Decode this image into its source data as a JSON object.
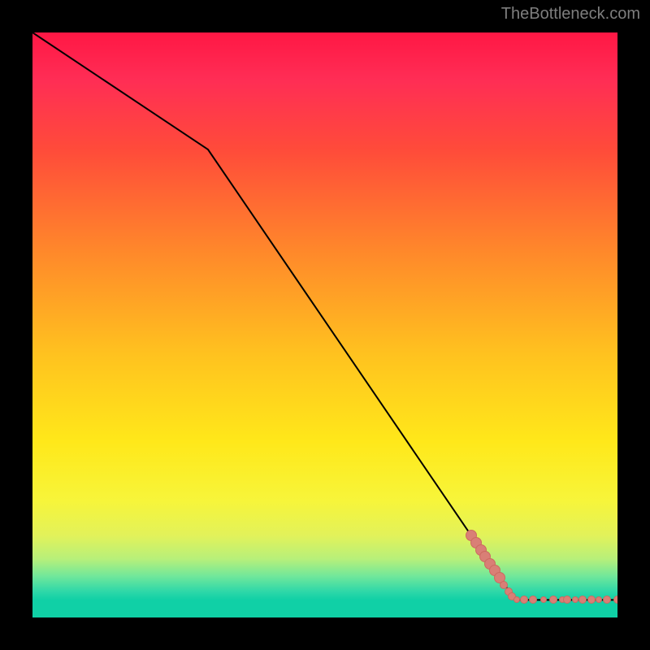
{
  "watermark": "TheBottleneck.com",
  "chart_data": {
    "type": "line",
    "title": "",
    "xlabel": "",
    "ylabel": "",
    "xlim": [
      0,
      100
    ],
    "ylim": [
      0,
      100
    ],
    "grid": false,
    "line": {
      "x": [
        0,
        30,
        82.5,
        100
      ],
      "y": [
        100,
        80,
        3,
        3
      ]
    },
    "scatter": [
      {
        "x": 75.0,
        "y": 14.0,
        "size": "big"
      },
      {
        "x": 75.8,
        "y": 12.8,
        "size": "big"
      },
      {
        "x": 76.6,
        "y": 11.6,
        "size": "big"
      },
      {
        "x": 77.4,
        "y": 10.4,
        "size": "big"
      },
      {
        "x": 78.2,
        "y": 9.2,
        "size": "big"
      },
      {
        "x": 79.0,
        "y": 8.0,
        "size": "big"
      },
      {
        "x": 79.8,
        "y": 6.8,
        "size": "big"
      },
      {
        "x": 80.6,
        "y": 5.6,
        "size": "normal"
      },
      {
        "x": 81.4,
        "y": 4.4,
        "size": "normal"
      },
      {
        "x": 82.0,
        "y": 3.6,
        "size": "normal"
      },
      {
        "x": 82.8,
        "y": 3.0,
        "size": "small"
      },
      {
        "x": 84.0,
        "y": 3.0,
        "size": "normal"
      },
      {
        "x": 85.6,
        "y": 3.0,
        "size": "normal"
      },
      {
        "x": 87.4,
        "y": 3.0,
        "size": "small"
      },
      {
        "x": 89.0,
        "y": 3.0,
        "size": "normal"
      },
      {
        "x": 90.6,
        "y": 3.0,
        "size": "small"
      },
      {
        "x": 91.4,
        "y": 3.0,
        "size": "normal"
      },
      {
        "x": 92.8,
        "y": 3.0,
        "size": "small"
      },
      {
        "x": 94.0,
        "y": 3.0,
        "size": "normal"
      },
      {
        "x": 95.5,
        "y": 3.0,
        "size": "normal"
      },
      {
        "x": 96.8,
        "y": 3.0,
        "size": "small"
      },
      {
        "x": 98.2,
        "y": 3.0,
        "size": "normal"
      },
      {
        "x": 100.0,
        "y": 3.0,
        "size": "normal"
      }
    ]
  }
}
